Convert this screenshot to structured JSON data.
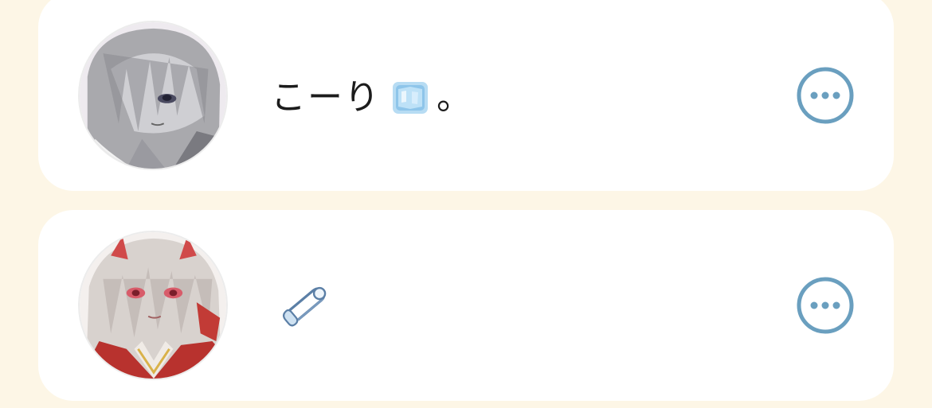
{
  "colors": {
    "page_background": "#fdf6e6",
    "card_background": "#ffffff",
    "accent": "#6a9fbf",
    "text": "#1c1c1c"
  },
  "users": [
    {
      "name": "こーり",
      "name_emoji": "ice-cube-icon",
      "name_suffix": "。",
      "avatar": "grayscale-anime-girl-avatar",
      "menu_icon": "more-options-icon"
    },
    {
      "name": "",
      "name_emoji": "safety-pin-icon",
      "name_suffix": "",
      "avatar": "anime-oni-girl-avatar",
      "menu_icon": "more-options-icon"
    }
  ]
}
